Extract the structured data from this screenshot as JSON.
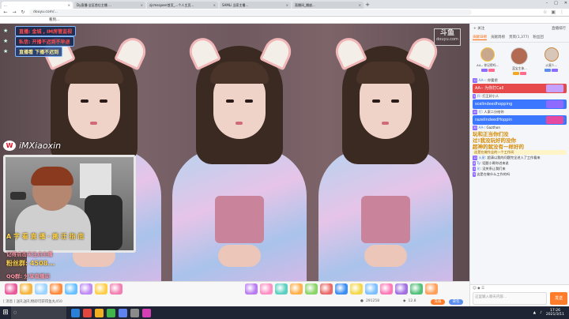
{
  "browser": {
    "tabs": [
      {
        "title": "...",
        "active": true
      },
      {
        "title": "Dy直播-全区首位主播 ..."
      },
      {
        "title": "zjcmsspeer首页_...个人主页..."
      },
      {
        "title": "SAMLi 当家主播..."
      },
      {
        "title": "直播间_播放..."
      }
    ],
    "new_tab": "+",
    "window_controls": [
      "–",
      "□",
      "✕"
    ],
    "url": "douyu.com/...",
    "bookmark": "看到..."
  },
  "stream": {
    "logo_top": "斗鱼",
    "logo_sub": "douyu.com",
    "banners": [
      {
        "text": "直播: 金城 , IM房管监视",
        "style": "red"
      },
      {
        "text": "私信: 开播不迟到不早退",
        "style": "red"
      },
      {
        "text": "直播看 下播不迟到",
        "style": "yellow"
      }
    ],
    "weibo_name": "iMXiaoxin",
    "info_lines": [
      {
        "text": "A 字 看 直 播 ·  搬 迁 指 南",
        "style": "big"
      },
      {
        "text": "记得点击关注点主播",
        "style": "small"
      },
      {
        "text": "粉丝群: 4508...",
        "style": "big"
      },
      {
        "text": "QQ群: 分享直播间",
        "style": "small"
      }
    ]
  },
  "giftbar": {
    "left_gifts": [
      {
        "label": "",
        "color": "#e85b9a"
      },
      {
        "label": "",
        "color": "#f5b53b"
      },
      {
        "label": "",
        "color": "#9cd3ff"
      },
      {
        "label": "",
        "color": "#ff8a3a"
      },
      {
        "label": "",
        "color": "#6ac0ff"
      },
      {
        "label": "",
        "color": "#c08af5"
      },
      {
        "label": "",
        "color": "#ffcf4a"
      },
      {
        "label": "",
        "color": "#f27fb0"
      }
    ],
    "right_gifts": [
      {
        "label": "",
        "color": "#b97cf0"
      },
      {
        "label": "",
        "color": "#ff8ec3"
      },
      {
        "label": "",
        "color": "#5bd0c0"
      },
      {
        "label": "",
        "color": "#ffb04a"
      },
      {
        "label": "",
        "color": "#8ad46a"
      },
      {
        "label": "",
        "color": "#ea6a6a"
      },
      {
        "label": "",
        "color": "#3d8ef0"
      },
      {
        "label": "",
        "color": "#f3d84a"
      },
      {
        "label": "",
        "color": "#7cc0ff"
      },
      {
        "label": "",
        "color": "#ff79b8"
      },
      {
        "label": "",
        "color": "#a070e0"
      },
      {
        "label": "",
        "color": "#52c07a"
      },
      {
        "label": "",
        "color": "#ff9f5a"
      }
    ],
    "notice": "[ 消息 ] 送礼送礼物即可获得鱼丸450",
    "stat_1": "291258",
    "stat_2": "12.8",
    "btn_1": "充值",
    "btn_2": "背包"
  },
  "sidebar": {
    "follow": "+ 关注",
    "rank_label": "直播排行",
    "tabs": [
      "贡献日榜",
      "贡献周榜",
      "贵宾(1,377)",
      "粉丝团"
    ],
    "ranks": [
      {
        "name": "AA-- 你记得吗..."
      },
      {
        "name": "蓝宝主体..."
      },
      {
        "name": "火星人..."
      }
    ],
    "chat": [
      {
        "kind": "line",
        "lv": "11",
        "name": "AA--",
        "text": "你要把"
      },
      {
        "kind": "hilite",
        "text": "AA-- 为你打Call",
        "color": "#e64a4a",
        "img": "#c5a2ff"
      },
      {
        "kind": "line",
        "lv": "5",
        "name": "开",
        "text": "打王好小人"
      },
      {
        "kind": "hilite",
        "text": "scelindeedhopping",
        "color": "#3b78ff",
        "img": "#8d6bff"
      },
      {
        "kind": "line",
        "lv": "20",
        "name": "打",
        "text": "人家二分给你"
      },
      {
        "kind": "hilite",
        "text": "razelindeedHoppin",
        "color": "#3b78ff",
        "img": "#e44aa0"
      },
      {
        "kind": "line",
        "lv": "30",
        "name": "AA-",
        "text": "Gazthon"
      },
      {
        "kind": "big",
        "text": "玩和正当你们没"
      },
      {
        "kind": "big",
        "text": "过!我没玩好的没你"
      },
      {
        "kind": "big",
        "text": "超神的就没有一样好的"
      },
      {
        "kind": "gold",
        "text": "这是在做作业的一个工作间"
      },
      {
        "kind": "line",
        "lv": "12",
        "name": "火星",
        "text": "超清以我的问题完全进入了工作看来"
      },
      {
        "kind": "line",
        "lv": "8",
        "name": "Ty",
        "text": "话题小哥你进来说"
      },
      {
        "kind": "line",
        "lv": "3",
        "name": "光",
        "text": "没关系让我们来"
      },
      {
        "kind": "line",
        "lv": "9",
        "name": "",
        "text": "这是在做什么工作的吗 "
      }
    ],
    "input_placeholder": "这里输入聊天内容...",
    "send": "发送",
    "input_hint": "☺ ◆ ☰"
  },
  "taskbar": {
    "start": "⊞",
    "search": "○",
    "apps": [
      "#2a7fd6",
      "#e3463d",
      "#f1b022",
      "#3fb54a",
      "#5e83f0",
      "#8a8a8a",
      "#d43fb4"
    ],
    "time": "17:26",
    "date": "2021/3/11"
  }
}
